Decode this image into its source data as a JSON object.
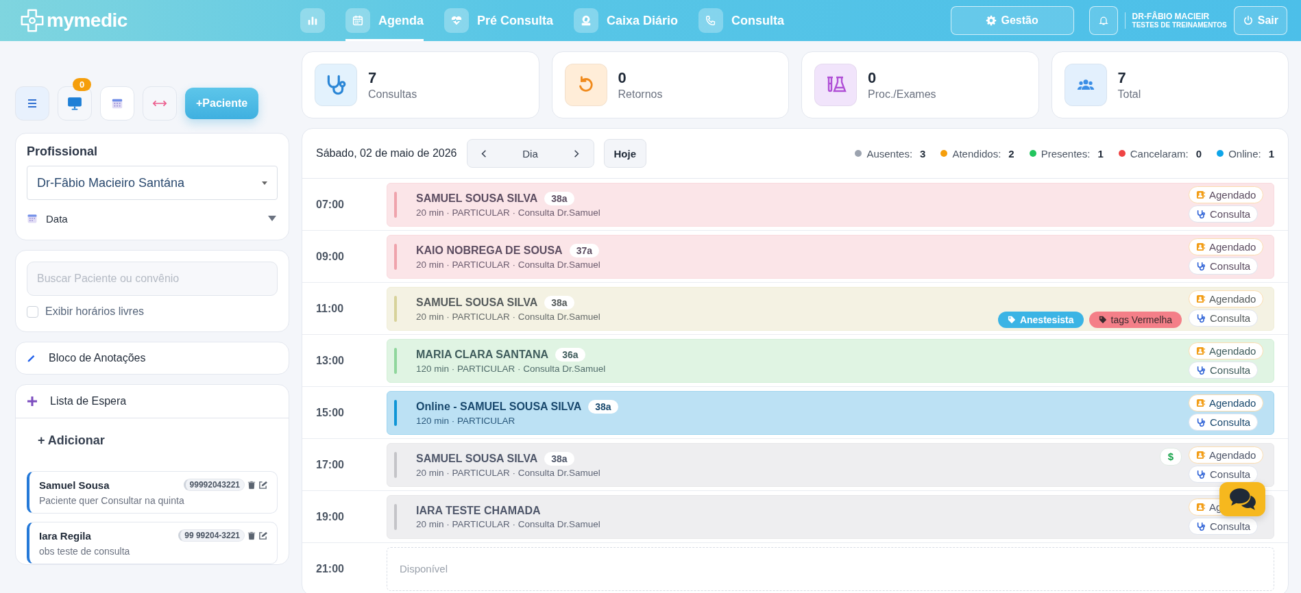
{
  "header": {
    "brand": "mymedic",
    "nav": [
      {
        "selected": false
      },
      {
        "label": "Agenda",
        "selected": true
      },
      {
        "label": "Pré Consulta",
        "selected": false
      },
      {
        "label": "Caixa Diário",
        "selected": false
      },
      {
        "label": "Consulta",
        "selected": false
      }
    ],
    "management": "Gestão",
    "user": {
      "name": "DR-FÂBIO MACIEIR",
      "subtitle": "TESTES DE TREINAMENTOS"
    },
    "logout": "Sair"
  },
  "toolbar": {
    "monitor_badge": "0",
    "add_patient": "+Paciente"
  },
  "professional": {
    "title": "Profissional",
    "selected": "Dr-Fâbio Macieiro Santána",
    "date_label": "Data"
  },
  "search": {
    "placeholder": "Buscar Paciente ou convênio",
    "free_slots": {
      "label": "Exibir horários livres",
      "checked": false
    }
  },
  "notes": {
    "title": "Bloco de Anotações"
  },
  "waiting_list": {
    "title": "Lista de Espera",
    "add": "+ Adicionar",
    "items": [
      {
        "name": "Samuel Sousa",
        "phone": "99992043221",
        "note": "Paciente quer Consultar na quinta"
      },
      {
        "name": "Iara Regila",
        "phone": "99 99204-3221",
        "note": "obs teste de consulta"
      }
    ]
  },
  "stats": [
    {
      "value": "7",
      "label": "Consultas"
    },
    {
      "value": "0",
      "label": "Retornos"
    },
    {
      "value": "0",
      "label": "Proc./Exames"
    },
    {
      "value": "7",
      "label": "Total"
    }
  ],
  "agenda": {
    "date": "Sábado, 02 de maio de 2026",
    "view": "Dia",
    "today": "Hoje",
    "legend": [
      {
        "label": "Ausentes:",
        "count": "3",
        "color": "#9ca3af"
      },
      {
        "label": "Atendidos:",
        "count": "2",
        "color": "#f59e0b"
      },
      {
        "label": "Presentes:",
        "count": "1",
        "color": "#22c55e"
      },
      {
        "label": "Cancelaram:",
        "count": "0",
        "color": "#ef4444"
      },
      {
        "label": "Online:",
        "count": "1",
        "color": "#0ea5e9"
      }
    ],
    "rows": [
      {
        "time": "07:00",
        "kind": "appointment",
        "color": "#efa3ac",
        "name": "SAMUEL SOUSA SILVA",
        "age": "38a",
        "details": "20 min · PARTICULAR · Consulta Dr.Samuel",
        "status": "Agendado",
        "type": "Consulta"
      },
      {
        "time": "09:00",
        "kind": "appointment",
        "color": "#efa3ac",
        "name": "KAIO NOBREGA DE SOUSA",
        "age": "37a",
        "details": "20 min · PARTICULAR · Consulta Dr.Samuel",
        "status": "Agendado",
        "type": "Consulta"
      },
      {
        "time": "11:00",
        "kind": "appointment",
        "color": "#d7d29a",
        "name": "SAMUEL SOUSA SILVA",
        "age": "38a",
        "details": "20 min · PARTICULAR · Consulta Dr.Samuel",
        "status": "Agendado",
        "type": "Consulta",
        "tags": [
          {
            "label": "Anestesista",
            "color": "#3bb4e5"
          },
          {
            "label": "tags Vermelha",
            "color": "#f47f88"
          }
        ]
      },
      {
        "time": "13:00",
        "kind": "appointment",
        "color": "#8fd69c",
        "name": "MARIA CLARA SANTANA",
        "age": "36a",
        "details": "120 min · PARTICULAR · Consulta Dr.Samuel",
        "status": "Agendado",
        "type": "Consulta"
      },
      {
        "time": "15:00",
        "kind": "appointment",
        "color": "#0e95d6",
        "name": "Online - SAMUEL SOUSA SILVA",
        "age": "38a",
        "details": "120 min · PARTICULAR",
        "status": "Agendado",
        "type": "Consulta"
      },
      {
        "time": "17:00",
        "kind": "appointment",
        "color": "#c4c4c8",
        "name": "SAMUEL SOUSA SILVA",
        "age": "38a",
        "details": "20 min · PARTICULAR · Consulta Dr.Samuel",
        "payment": "$",
        "status": "Agendado",
        "type": "Consulta"
      },
      {
        "time": "19:00",
        "kind": "appointment",
        "color": "#c4c4c8",
        "name": "IARA TESTE CHAMADA",
        "details": "20 min · PARTICULAR · Consulta Dr.Samuel",
        "status": "Ag",
        "type": "Consulta"
      },
      {
        "time": "21:00",
        "kind": "free",
        "label": "Disponível"
      }
    ]
  }
}
